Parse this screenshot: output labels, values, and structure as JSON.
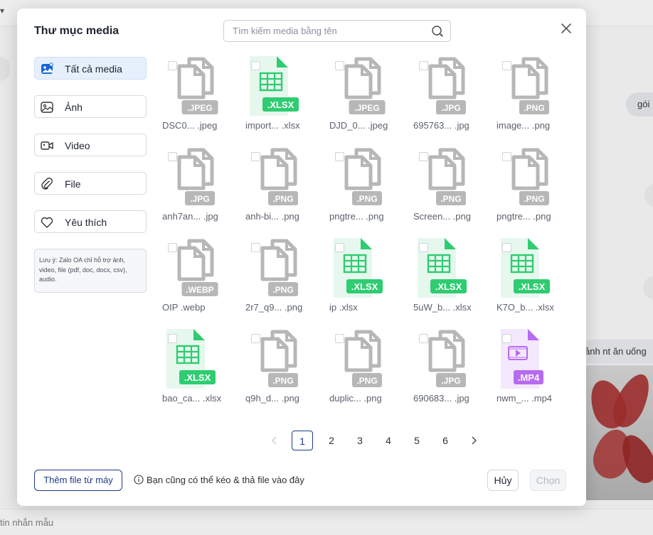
{
  "background": {
    "chip_glyph": "▾",
    "bubble_right": "gói",
    "bubble_chat": "ảnh nt ăn uống",
    "input_hint": "tin nhắn mẫu"
  },
  "modal": {
    "title": "Thư mục media",
    "search_placeholder": "Tìm kiếm media bằng tên",
    "close_icon": "close-icon"
  },
  "sidebar": {
    "items": [
      {
        "label": "Tất cả media",
        "icon": "image-gallery-icon",
        "active": true
      },
      {
        "label": "Ảnh",
        "icon": "photo-icon",
        "active": false
      },
      {
        "label": "Video",
        "icon": "video-icon",
        "active": false
      },
      {
        "label": "File",
        "icon": "attachment-icon",
        "active": false
      },
      {
        "label": "Yêu thích",
        "icon": "heart-icon",
        "active": false
      }
    ],
    "note": "Lưu ý: Zalo OA chỉ hỗ trợ ảnh, video, file (pdf, doc, docx, csv), audio."
  },
  "files": [
    {
      "name": "DSC0... .jpeg",
      "ext": ".JPEG",
      "kind": "image"
    },
    {
      "name": "import... .xlsx",
      "ext": ".XLSX",
      "kind": "sheet"
    },
    {
      "name": "DJD_0... .jpeg",
      "ext": ".JPEG",
      "kind": "image"
    },
    {
      "name": "695763... .jpg",
      "ext": ".JPG",
      "kind": "image"
    },
    {
      "name": "image... .png",
      "ext": ".PNG",
      "kind": "image"
    },
    {
      "name": "anh7an... .jpg",
      "ext": ".JPG",
      "kind": "image"
    },
    {
      "name": "anh-bi... .png",
      "ext": ".PNG",
      "kind": "image"
    },
    {
      "name": "pngtre... .png",
      "ext": ".PNG",
      "kind": "image"
    },
    {
      "name": "Screen... .png",
      "ext": ".PNG",
      "kind": "image"
    },
    {
      "name": "pngtre... .png",
      "ext": ".PNG",
      "kind": "image"
    },
    {
      "name": "OIP      .webp",
      "ext": ".WEBP",
      "kind": "image"
    },
    {
      "name": "2r7_q9... .png",
      "ext": ".PNG",
      "kind": "image"
    },
    {
      "name": "ip            .xlsx",
      "ext": ".XLSX",
      "kind": "sheet"
    },
    {
      "name": "5uW_b... .xlsx",
      "ext": ".XLSX",
      "kind": "sheet"
    },
    {
      "name": "K7O_b... .xlsx",
      "ext": ".XLSX",
      "kind": "sheet"
    },
    {
      "name": "bao_ca... .xlsx",
      "ext": ".XLSX",
      "kind": "sheet"
    },
    {
      "name": "q9h_d... .png",
      "ext": ".PNG",
      "kind": "image"
    },
    {
      "name": "duplic... .png",
      "ext": ".PNG",
      "kind": "image"
    },
    {
      "name": "690683... .jpg",
      "ext": ".JPG",
      "kind": "image"
    },
    {
      "name": "nwm_... .mp4",
      "ext": ".MP4",
      "kind": "video"
    }
  ],
  "pagination": {
    "pages": [
      "1",
      "2",
      "3",
      "4",
      "5",
      "6"
    ],
    "current": "1",
    "prev_icon": "chevron-left-icon",
    "next_icon": "chevron-right-icon"
  },
  "footer": {
    "add_label": "Thêm file từ máy",
    "hint": "Bạn cũng có thể kéo & thả file vào đây",
    "cancel_label": "Hủy",
    "choose_label": "Chọn"
  },
  "colors": {
    "accent": "#1e3a8a",
    "active_bg": "#e5f0fc",
    "sheet_green": "#2fcc71",
    "video_purple": "#b66bf0",
    "image_gray": "#b7b7b7"
  }
}
